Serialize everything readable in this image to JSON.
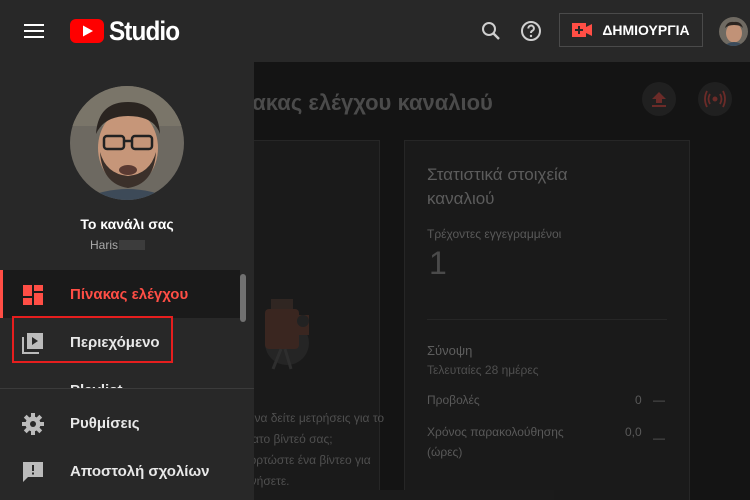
{
  "header": {
    "logo_text": "Studio",
    "create_label": "ΔΗΜΙΟΥΡΓΙΑ"
  },
  "drawer": {
    "channel_label": "Το κανάλι σας",
    "channel_name": "Haris",
    "nav": [
      {
        "label": "Πίνακας ελέγχου",
        "active": true
      },
      {
        "label": "Περιεχόμενο"
      },
      {
        "label": "Playlist"
      }
    ],
    "bottom_nav": [
      {
        "label": "Ρυθμίσεις"
      },
      {
        "label": "Αποστολή σχολίων"
      }
    ]
  },
  "main": {
    "title": "Πίνακας ελέγχου καναλιού",
    "upload_lines": [
      "Θέλετε να δείτε μετρήσεις για το",
      "πρόσφατο βίντεό σας;",
      "Μεταφορτώστε ένα βίντεο για",
      "να ξεκινήσετε."
    ],
    "stats": {
      "heading_line1": "Στατιστικά στοιχεία",
      "heading_line2": "καναλιού",
      "subscribers_label": "Τρέχοντες εγγεγραμμένοι",
      "subscribers_value": "1",
      "summary_label": "Σύνοψη",
      "summary_period": "Τελευταίες 28 ημέρες",
      "views_label": "Προβολές",
      "views_value": "0",
      "views_trend": "—",
      "watch_label_line1": "Χρόνος παρακολούθησης",
      "watch_label_line2": "(ώρες)",
      "watch_value": "0,0",
      "watch_trend": "—"
    }
  },
  "colors": {
    "accent": "#ff4e45",
    "youtube_red": "#ff0000",
    "topbar_bg": "#282828",
    "highlight": "#e61e1e"
  },
  "icons": {
    "menu": "hamburger-icon",
    "search": "search-icon",
    "help": "help-icon",
    "create": "video-create-icon",
    "dashboard": "dashboard-icon",
    "content": "video-library-icon",
    "playlist": "playlist-icon",
    "settings": "gear-icon",
    "feedback": "feedback-icon"
  }
}
